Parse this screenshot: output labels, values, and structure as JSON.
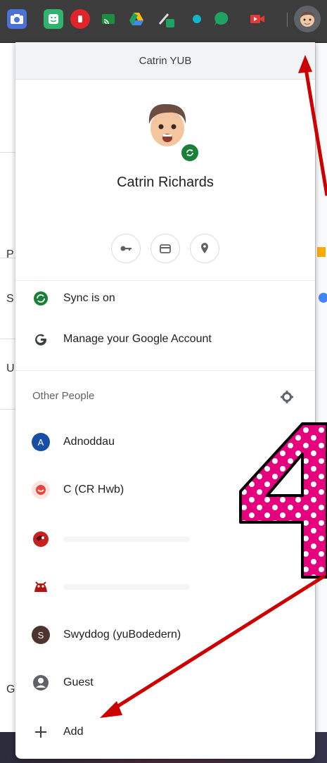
{
  "popup": {
    "header_title": "Catrin YUB",
    "profile_name": "Catrin Richards",
    "quick_actions": [
      "key-icon",
      "card-icon",
      "location-icon"
    ],
    "sync_label": "Sync is on",
    "manage_label": "Manage your Google Account",
    "other_people_label": "Other People",
    "people": [
      {
        "initial": "A",
        "name": "Adnoddau",
        "color": "#174ea6"
      },
      {
        "initial": "",
        "name": "C (CR Hwb)",
        "color": "#e8453c"
      },
      {
        "initial": "",
        "name": "",
        "color": "#c5221f"
      },
      {
        "initial": "",
        "name": "",
        "color": "#b31412"
      },
      {
        "initial": "S",
        "name": "Swyddog (yuBodedern)",
        "color": "#4e342e"
      }
    ],
    "guest_label": "Guest",
    "add_label": "Add"
  },
  "background": {
    "letters": [
      "P",
      "S",
      "U",
      "G"
    ]
  },
  "annotation": {
    "number": "4",
    "arrow_color": "#cc0000",
    "number_color": "#e6007e"
  }
}
